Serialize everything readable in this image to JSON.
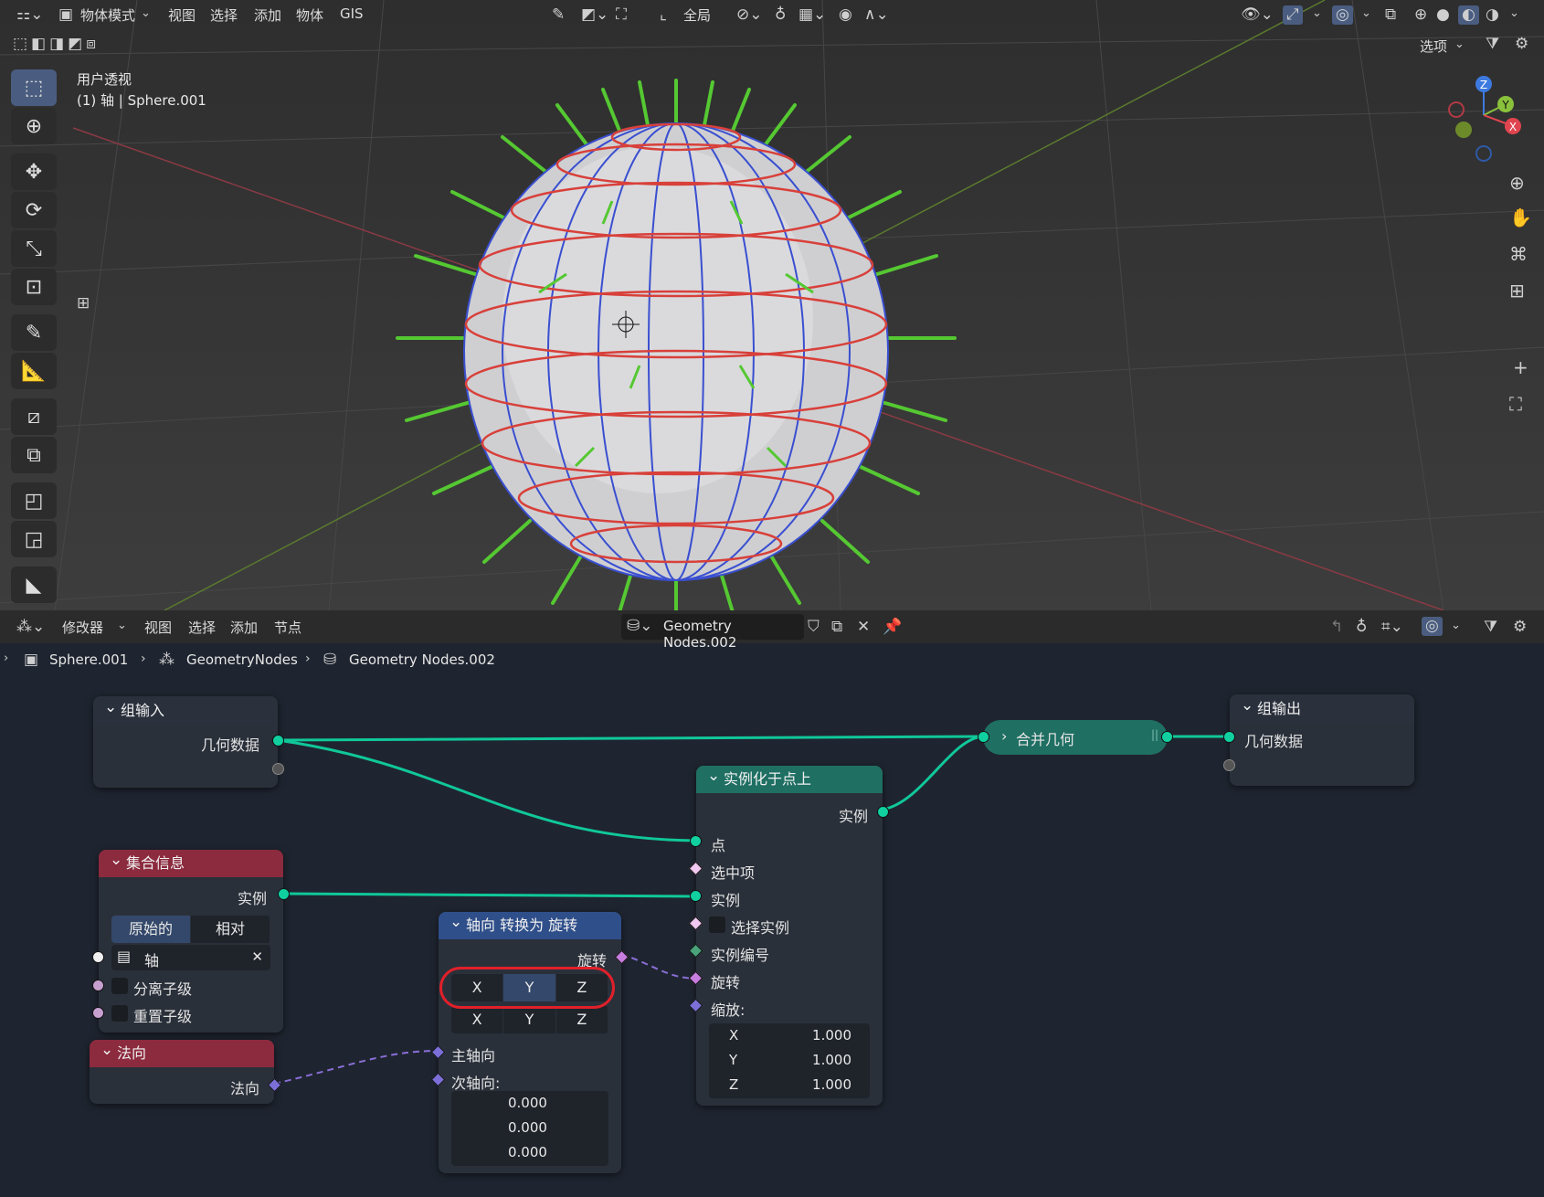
{
  "viewport_header": {
    "mode": "物体模式",
    "menu": [
      "视图",
      "选择",
      "添加",
      "物体",
      "GIS"
    ],
    "transform": "全局",
    "options": "选项"
  },
  "viewport": {
    "view_label": "用户透视",
    "object_label": "(1) 轴 | Sphere.001",
    "gizmo": {
      "z": "Z",
      "y": "Y",
      "x": "X"
    }
  },
  "node_header": {
    "editor": "修改器",
    "menu": [
      "视图",
      "选择",
      "添加",
      "节点"
    ],
    "tree_name": "Geometry Nodes.002"
  },
  "breadcrumb": [
    "Sphere.001",
    "GeometryNodes",
    "Geometry Nodes.002"
  ],
  "nodes": {
    "group_input": {
      "title": "组输入",
      "geometry": "几何数据"
    },
    "group_output": {
      "title": "组输出",
      "geometry": "几何数据"
    },
    "join_geometry": {
      "title": "合并几何"
    },
    "instance_on_points": {
      "title": "实例化于点上",
      "out_instances": "实例",
      "points": "点",
      "selection": "选中项",
      "instance": "实例",
      "pick_instance": "选择实例",
      "instance_index": "实例编号",
      "rotation": "旋转",
      "scale": "缩放:",
      "scale_x_label": "X",
      "scale_x": "1.000",
      "scale_y_label": "Y",
      "scale_y": "1.000",
      "scale_z_label": "Z",
      "scale_z": "1.000"
    },
    "collection_info": {
      "title": "集合信息",
      "out_instances": "实例",
      "mode_original": "原始的",
      "mode_relative": "相对",
      "collection": "轴",
      "separate_children": "分离子级",
      "reset_children": "重置子级"
    },
    "normal": {
      "title": "法向",
      "output": "法向"
    },
    "align_to_rotation": {
      "title": "轴向 转换为 旋转",
      "out_rotation": "旋转",
      "axis_a": [
        "X",
        "Y",
        "Z"
      ],
      "axis_a_selected": "Y",
      "axis_b": [
        "X",
        "Y",
        "Z"
      ],
      "primary_axis": "主轴向",
      "secondary_axis": "次轴向:",
      "sec_x": "0.000",
      "sec_y": "0.000",
      "sec_z": "0.000"
    }
  },
  "colors": {
    "viewport_bg": "#3a3a3a",
    "node_bg": "#1f2530",
    "geometry_socket": "#10d0a0",
    "group_header": "#2f3846",
    "instance_header": "#1f6f63",
    "input_header": "#8c2a3e",
    "convert_header": "#2f4f8a",
    "highlight_ring": "#e0202a"
  }
}
